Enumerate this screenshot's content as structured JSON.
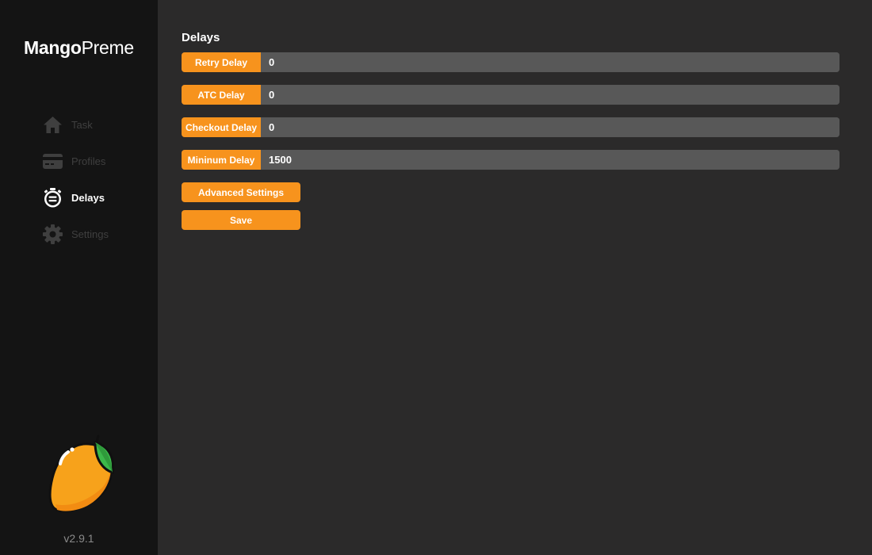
{
  "app": {
    "brand_bold": "Mango",
    "brand_regular": "Preme",
    "version": "v2.9.1"
  },
  "sidebar": {
    "items": [
      {
        "label": "Task",
        "icon": "home-icon",
        "active": false
      },
      {
        "label": "Profiles",
        "icon": "card-icon",
        "active": false
      },
      {
        "label": "Delays",
        "icon": "stopwatch-icon",
        "active": true
      },
      {
        "label": "Settings",
        "icon": "gear-icon",
        "active": false
      }
    ]
  },
  "main": {
    "title": "Delays",
    "fields": [
      {
        "label": "Retry Delay",
        "value": "0"
      },
      {
        "label": "ATC Delay",
        "value": "0"
      },
      {
        "label": "Checkout Delay",
        "value": "0"
      },
      {
        "label": "Mininum Delay",
        "value": "1500"
      }
    ],
    "advanced_label": "Advanced Settings",
    "save_label": "Save"
  },
  "colors": {
    "accent": "#f7931d",
    "sidebar_bg": "#141414",
    "main_bg": "#2b2a2a",
    "field_bg": "#585858",
    "inactive_nav": "#3f3f3f"
  }
}
